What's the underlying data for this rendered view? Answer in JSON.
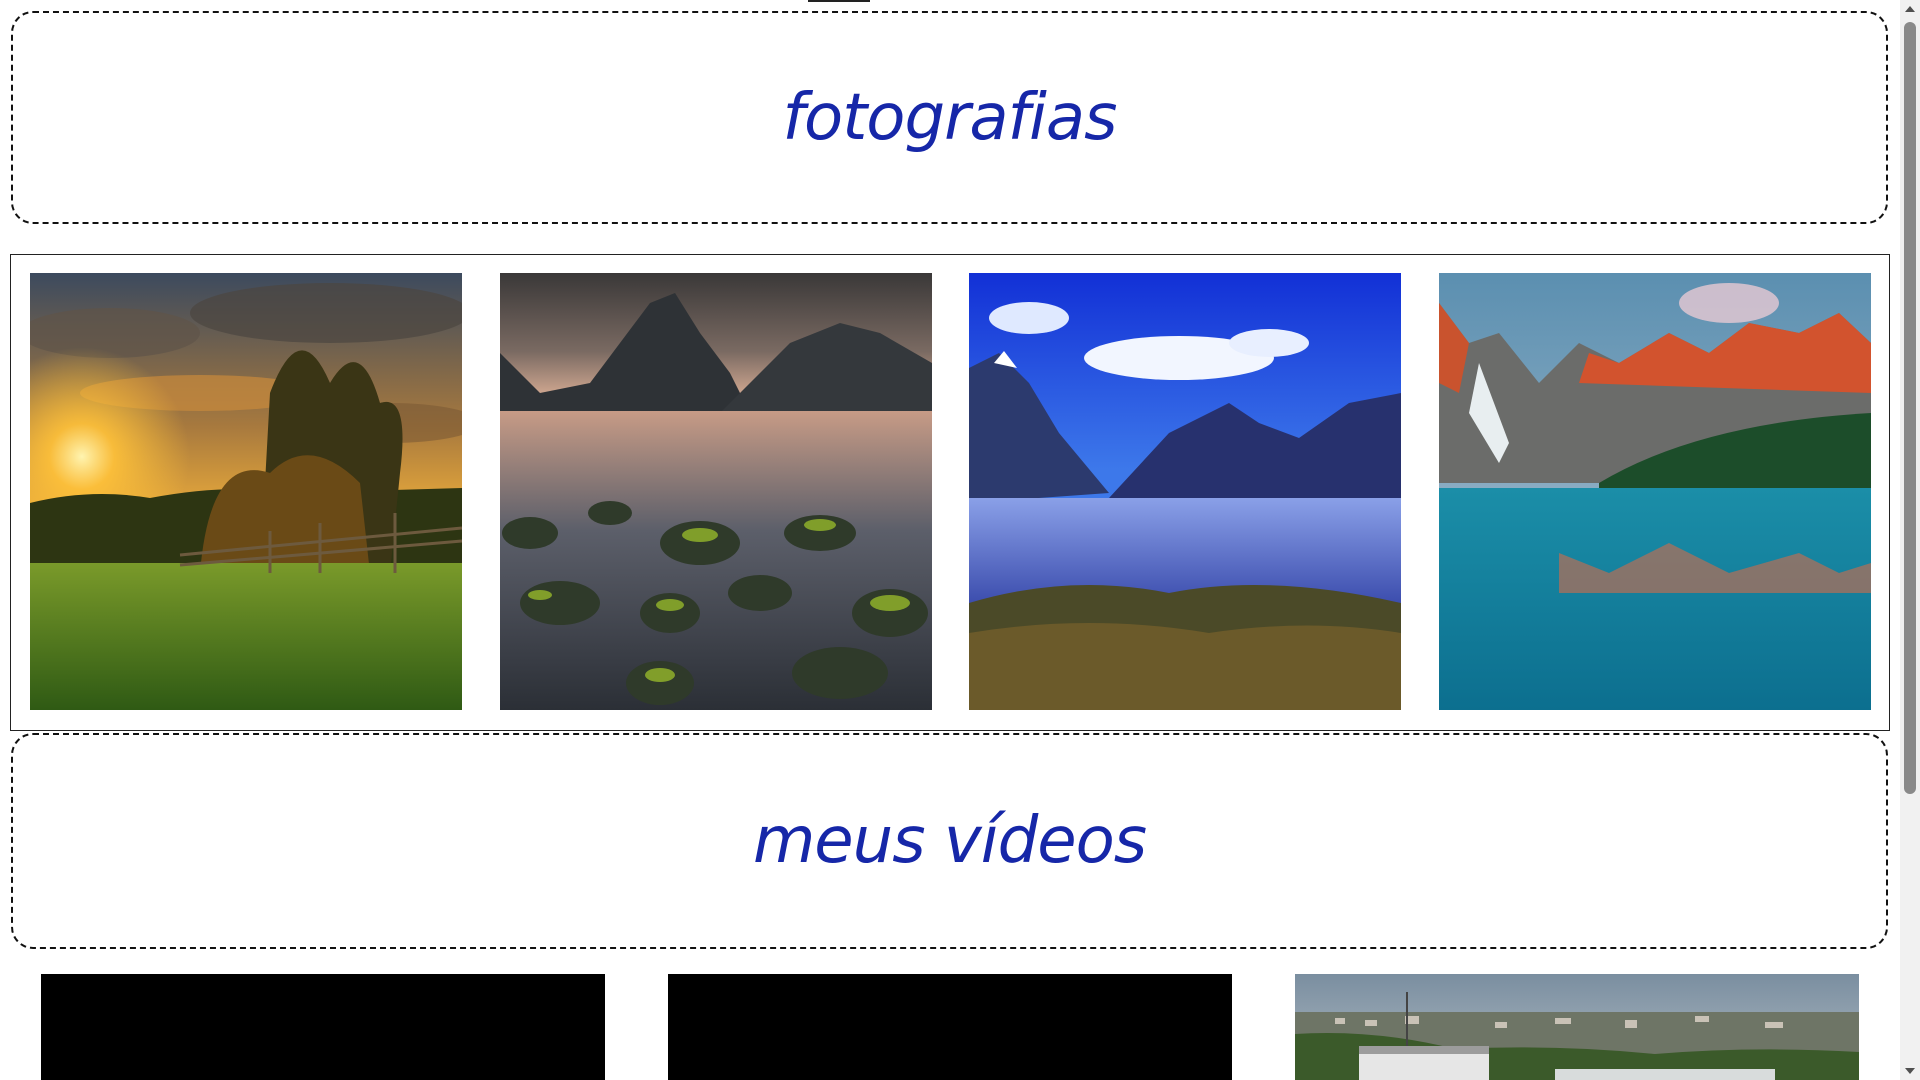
{
  "photos_section": {
    "title": "fotografias",
    "images": [
      {
        "name": "sunset-meadow-photo"
      },
      {
        "name": "mountain-rocks-lake-photo"
      },
      {
        "name": "blue-fjord-lake-photo"
      },
      {
        "name": "turquoise-mountain-lake-photo"
      }
    ]
  },
  "videos_section": {
    "title": "meus vídeos",
    "videos": [
      {
        "name": "video-player-1"
      },
      {
        "name": "video-player-2"
      },
      {
        "name": "video-player-3"
      }
    ]
  },
  "colors": {
    "heading": "#1627a8",
    "border": "#111111",
    "video_background": "#000000"
  }
}
